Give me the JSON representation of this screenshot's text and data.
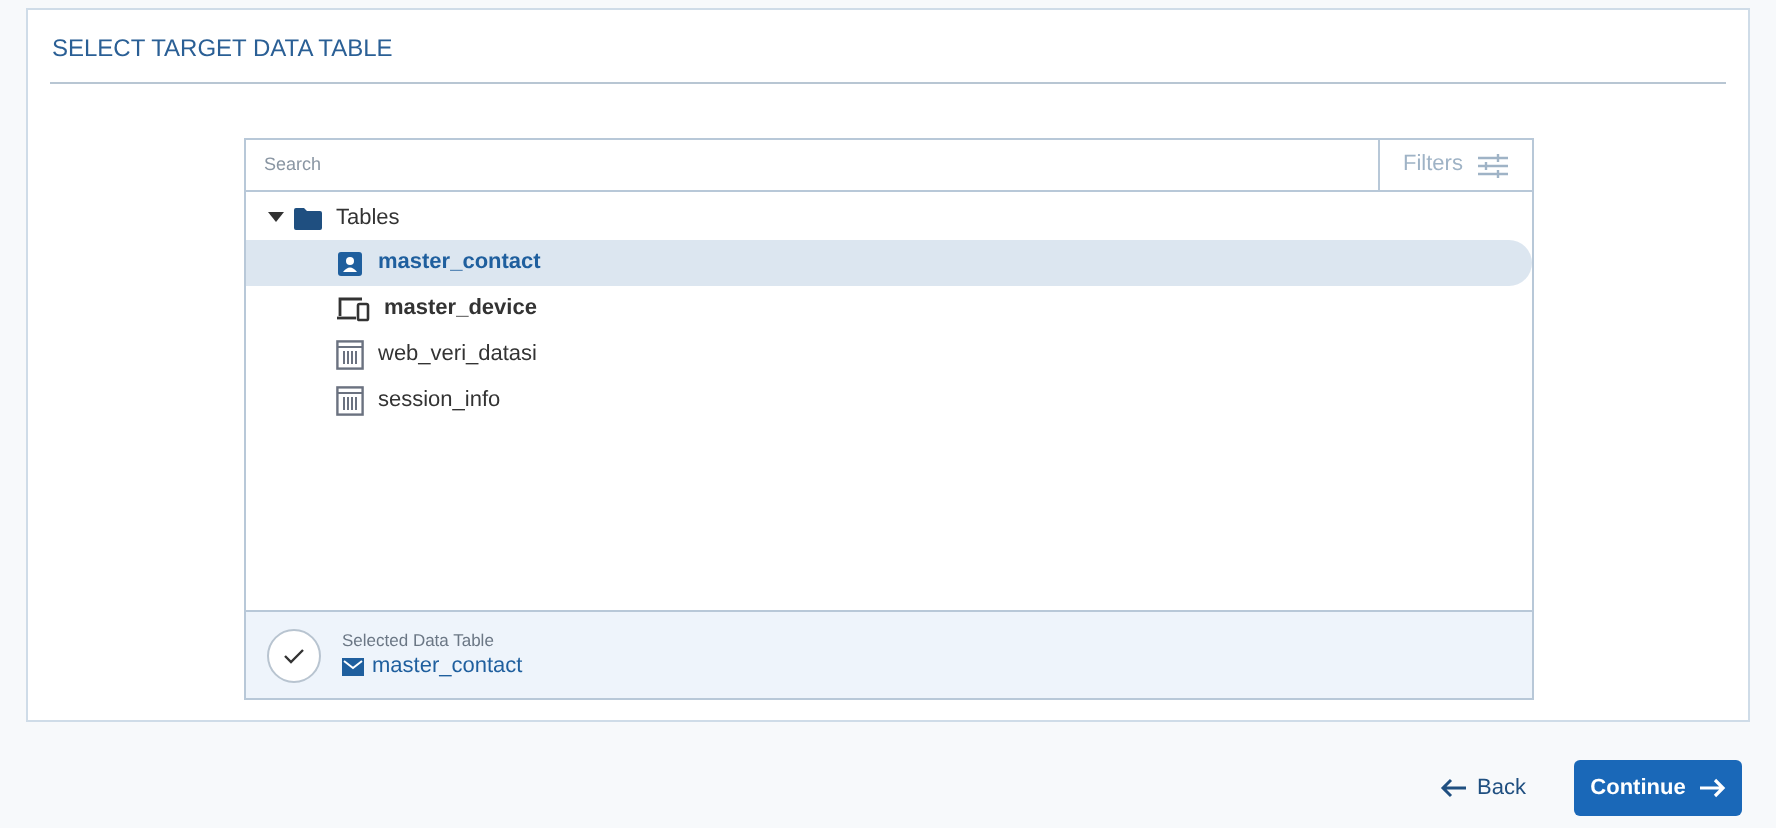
{
  "title": "SELECT TARGET DATA TABLE",
  "search": {
    "placeholder": "Search"
  },
  "filters_button": "Filters",
  "tree": {
    "label": "Tables",
    "expanded": true,
    "children": [
      {
        "label": "master_contact",
        "kind": "contact",
        "bold": true,
        "selected": true
      },
      {
        "label": "master_device",
        "kind": "device",
        "bold": true,
        "selected": false
      },
      {
        "label": "web_veri_datasi",
        "kind": "table",
        "bold": false,
        "selected": false
      },
      {
        "label": "session_info",
        "kind": "table",
        "bold": false,
        "selected": false
      }
    ]
  },
  "selection": {
    "caption": "Selected Data Table",
    "value": "master_contact"
  },
  "buttons": {
    "back": "Back",
    "continue": "Continue"
  }
}
